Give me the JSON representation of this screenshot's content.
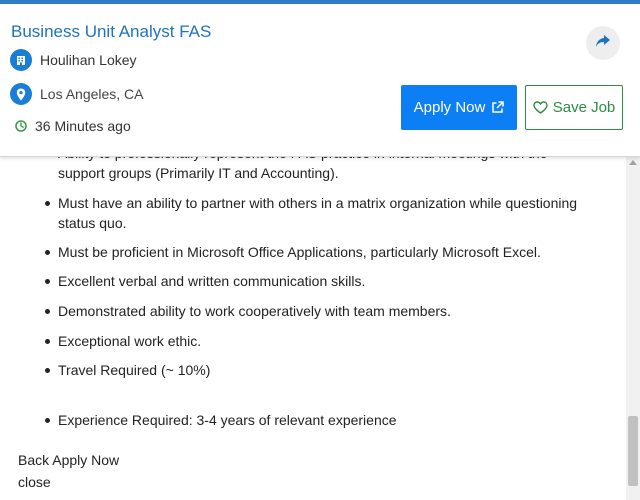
{
  "job": {
    "title": "Business Unit Analyst FAS",
    "company": "Houlihan Lokey",
    "location": "Los Angeles, CA",
    "posted": "36 Minutes ago"
  },
  "actions": {
    "apply_label": "Apply Now",
    "save_label": "Save Job"
  },
  "description": {
    "bullets": [
      "Ability to professionally represent the FAS practice in internal meetings with the support groups (Primarily IT and Accounting).",
      "Must have an ability to partner with others in a matrix organization while questioning status quo.",
      "Must be proficient in Microsoft Office Applications, particularly Microsoft Excel.",
      "Excellent verbal and written communication skills.",
      "Demonstrated ability to work cooperatively with team members.",
      "Exceptional work ethic.",
      "Travel Required (~ 10%)",
      "Experience Required: 3-4 years of relevant experience"
    ]
  },
  "footer": {
    "back_label": "Back",
    "apply_label": "Apply Now",
    "close_label": "close"
  },
  "colors": {
    "accent_blue": "#1e73be",
    "apply_button": "#0d7ff5",
    "save_green": "#2f8a45",
    "time_green": "#3c9a4c"
  },
  "icons": {
    "share": "share-arrow-icon",
    "company": "building-icon",
    "location": "map-pin-icon",
    "time": "clock-icon",
    "external": "external-link-icon",
    "save": "heart-icon"
  }
}
